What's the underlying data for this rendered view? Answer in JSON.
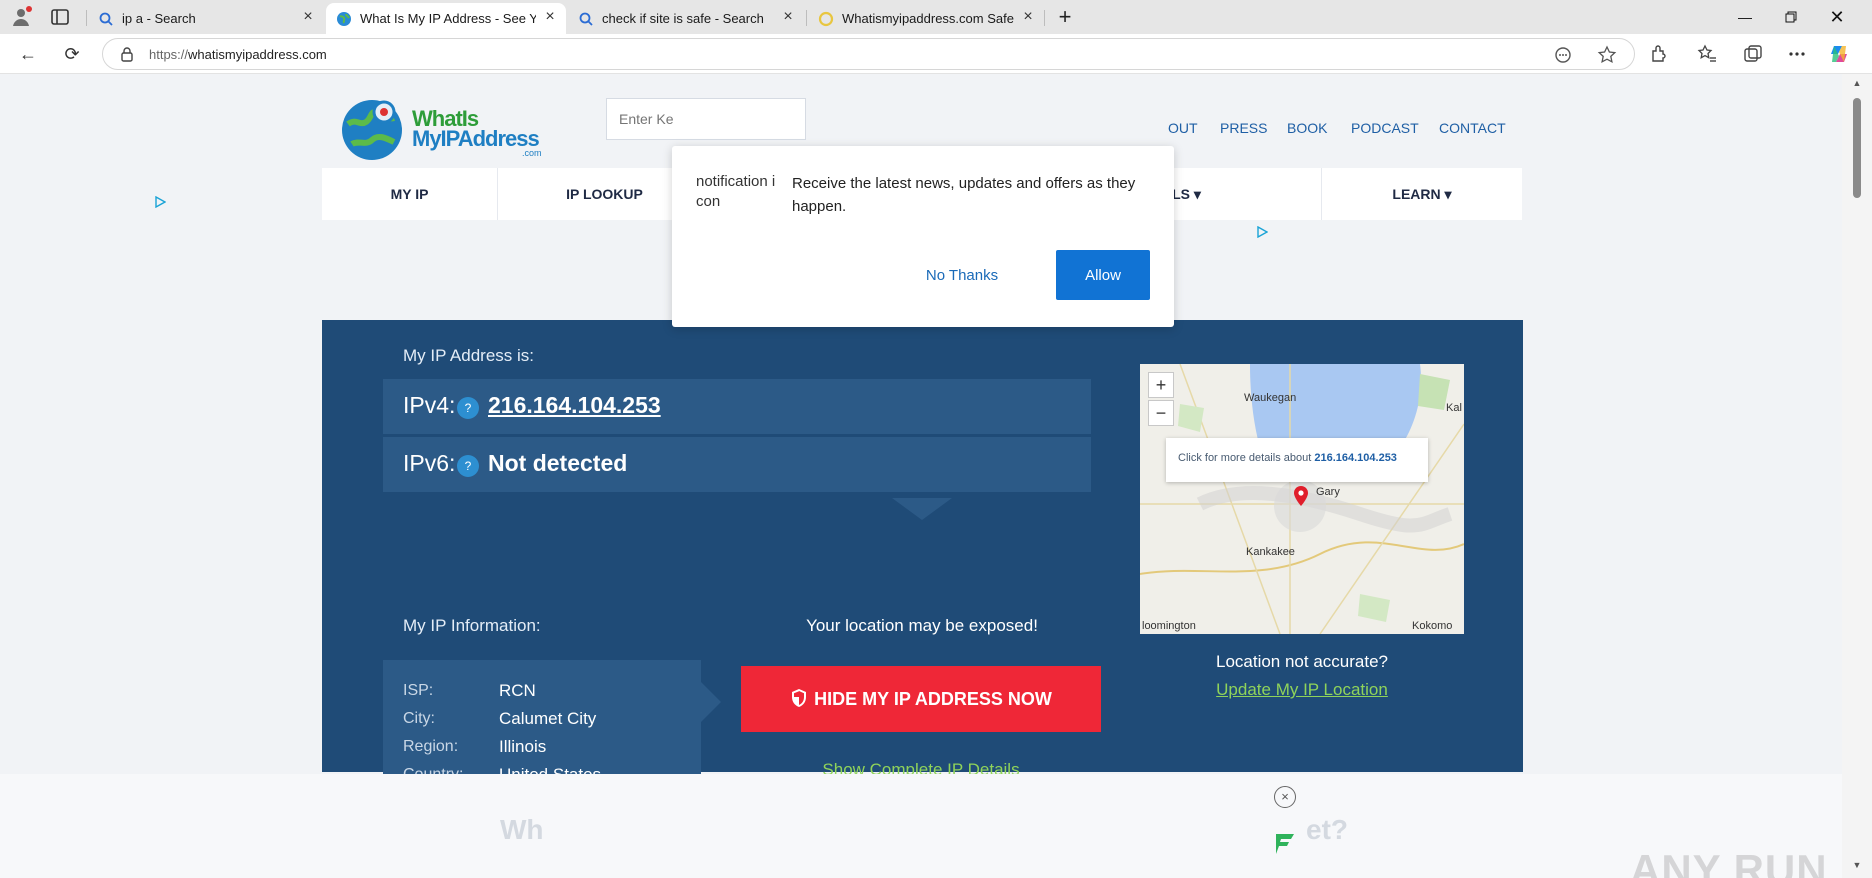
{
  "browser": {
    "tabs": [
      {
        "title": "ip a - Search",
        "icon": "search-icon"
      },
      {
        "title": "What Is My IP Address - See Your",
        "icon": "globe-icon"
      },
      {
        "title": "check if site is safe - Search",
        "icon": "search-icon"
      },
      {
        "title": "Whatismyipaddress.com Safe? Ch",
        "icon": "loading-icon"
      }
    ],
    "url_scheme": "https://",
    "url_host": "whatismyipaddress.com",
    "controls": [
      "minimize-icon",
      "maximize-icon",
      "close-icon"
    ]
  },
  "site": {
    "logo_line1": "WhatIs",
    "logo_line2": "MyIPAddress",
    "logo_suffix": ".com",
    "search_placeholder": "Enter Ke",
    "top_links": [
      "OUT",
      "PRESS",
      "BOOK",
      "PODCAST",
      "CONTACT"
    ],
    "nav": [
      "MY IP",
      "IP LOOKUP",
      "TOOLS ▾",
      "LEARN ▾"
    ]
  },
  "hero": {
    "my_ip_label": "My IP Address is:",
    "ipv4_label": "IPv4:",
    "ipv4_value": "216.164.104.253",
    "ipv6_label": "IPv6:",
    "ipv6_value": "Not detected",
    "help_glyph": "?",
    "info_label": "My IP Information:",
    "info": [
      {
        "k": "ISP:",
        "v": "RCN"
      },
      {
        "k": "City:",
        "v": "Calumet City"
      },
      {
        "k": "Region:",
        "v": "Illinois"
      },
      {
        "k": "Country:",
        "v": "United States"
      }
    ],
    "exposed_text": "Your location may be exposed!",
    "hide_button": "HIDE MY IP ADDRESS NOW",
    "details_link": "Show Complete IP Details",
    "map": {
      "zoom_in": "+",
      "zoom_out": "−",
      "tip_prefix": "Click for more details about",
      "tip_ip": "216.164.104.253",
      "places": [
        "Waukegan",
        "Gary",
        "Kankakee",
        "loomington",
        "Kokomo",
        "Kal"
      ]
    },
    "location_question": "Location not accurate?",
    "location_link": "Update My IP Location"
  },
  "bottom": {
    "faded_left": "Wh",
    "faded_right": "et?",
    "close_glyph": "×"
  },
  "notification": {
    "icon_alt": "notification icon",
    "message": "Receive the latest news, updates and offers as they happen.",
    "decline": "No Thanks",
    "accept": "Allow"
  },
  "watermark": {
    "text": "ANY RUN"
  },
  "colors": {
    "hero_bg": "#1f4b77",
    "hero_row": "#2c5a87",
    "cta_red": "#ef2737",
    "link_green": "#8fd35a",
    "allow_blue": "#1173d4"
  }
}
